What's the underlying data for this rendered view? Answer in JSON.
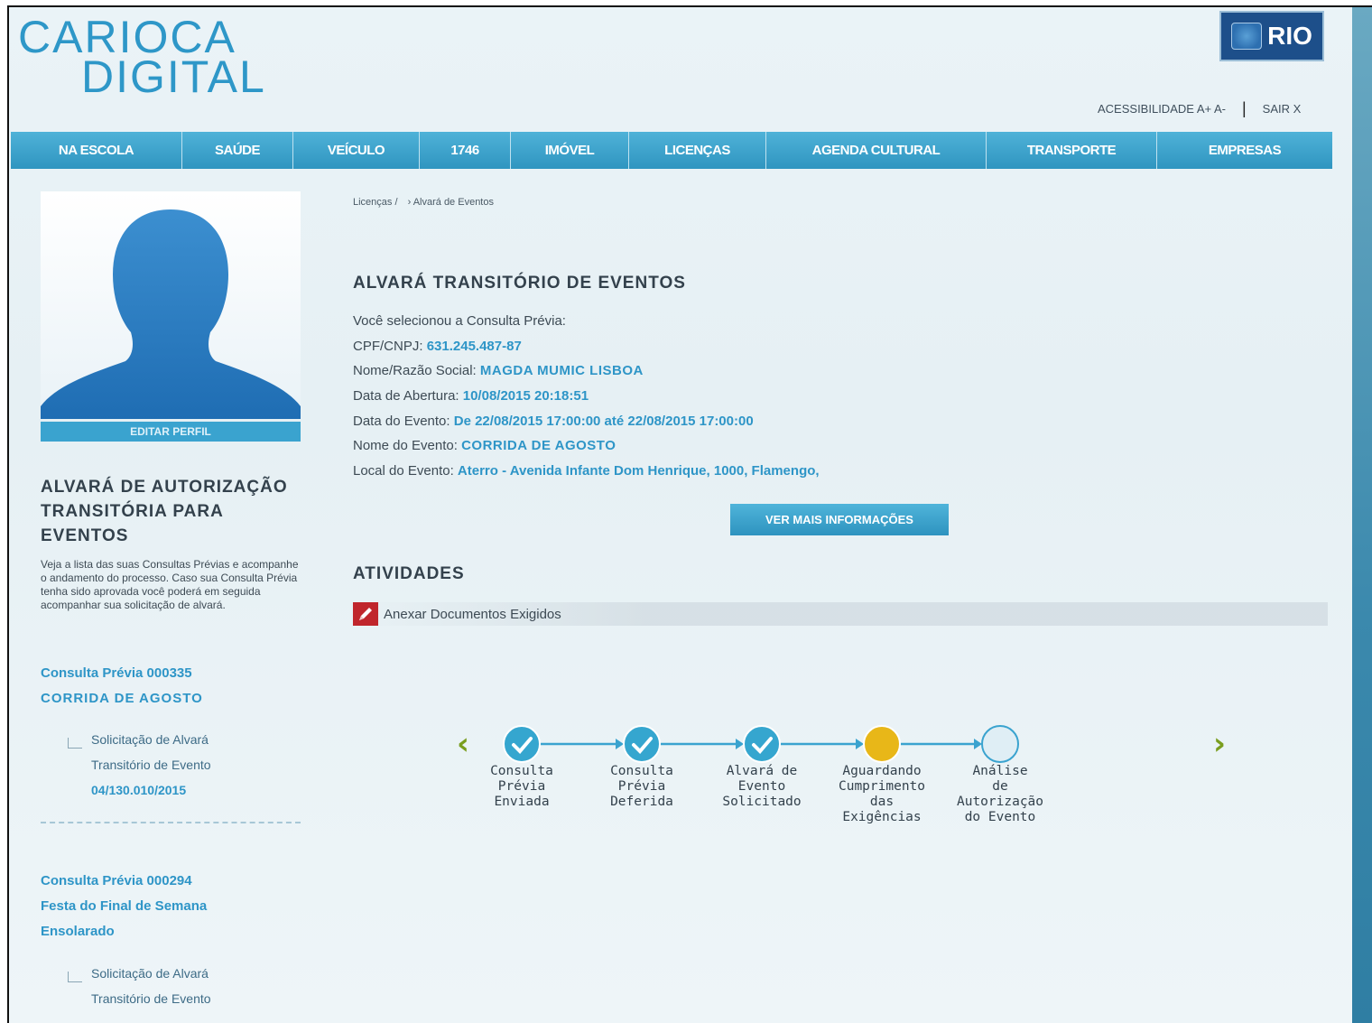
{
  "header": {
    "logo_line1": "CARIOCA",
    "logo_line2": "DIGITAL",
    "rio_badge": "RIO",
    "accessibility": "ACESSIBILIDADE A+ A-",
    "separator": "|",
    "logout": "SAIR X"
  },
  "nav": {
    "items": [
      {
        "label": "NA ESCOLA"
      },
      {
        "label": "SAÚDE"
      },
      {
        "label": "VEÍCULO"
      },
      {
        "label": "1746"
      },
      {
        "label": "IMÓVEL"
      },
      {
        "label": "LICENÇAS"
      },
      {
        "label": "AGENDA CULTURAL"
      },
      {
        "label": "TRANSPORTE"
      },
      {
        "label": "EMPRESAS"
      }
    ]
  },
  "sidebar": {
    "edit_profile": "EDITAR PERFIL",
    "title": "ALVARÁ DE AUTORIZAÇÃO TRANSITÓRIA PARA EVENTOS",
    "description": "Veja a lista das suas Consultas Prévias e acompanhe o andamento do processo. Caso sua Consulta Prévia tenha sido aprovada você poderá em seguida acompanhar sua solicitação de alvará.",
    "consultas": [
      {
        "label": "Consulta Prévia 000335",
        "event": "CORRIDA DE AGOSTO",
        "sub1": "Solicitação de Alvará",
        "sub2": "Transitório de Evento",
        "number": "04/130.010/2015"
      },
      {
        "label": "Consulta Prévia 000294",
        "event_line1": "Festa do Final de Semana",
        "event_line2": "Ensolarado",
        "sub1": "Solicitação de Alvará",
        "sub2": "Transitório de Evento"
      }
    ]
  },
  "breadcrumb": {
    "item1": "Licenças /",
    "item2": "› Alvará de Eventos"
  },
  "main": {
    "title": "ALVARÁ TRANSITÓRIO DE EVENTOS",
    "intro": "Você selecionou a Consulta Prévia:",
    "cpf_label": "CPF/CNPJ:",
    "cpf_value": "631.245.487-87",
    "nome_label": "Nome/Razão Social:",
    "nome_value": "MAGDA MUMIC LISBOA",
    "abertura_label": "Data de Abertura:",
    "abertura_value": "10/08/2015 20:18:51",
    "evento_data_label": "Data do Evento:",
    "evento_data_value": "De 22/08/2015 17:00:00 até 22/08/2015 17:00:00",
    "evento_nome_label": "Nome do Evento:",
    "evento_nome_value": "CORRIDA DE AGOSTO",
    "local_label": "Local do Evento:",
    "local_value": "Aterro - Avenida Infante Dom Henrique, 1000, Flamengo,",
    "more_button": "VER MAIS INFORMAÇÕES",
    "activities_title": "ATIVIDADES",
    "activity_1": "Anexar Documentos Exigidos"
  },
  "timeline": {
    "colors": {
      "done": "#35a6cf",
      "current": "#e8b718",
      "pending": "#dfeef5",
      "line": "#3aa3cf",
      "arrow": "#7a9e1f"
    },
    "steps": [
      {
        "state": "done",
        "lines": [
          "Consulta",
          "Prévia",
          "Enviada"
        ]
      },
      {
        "state": "done",
        "lines": [
          "Consulta",
          "Prévia",
          "Deferida"
        ]
      },
      {
        "state": "done",
        "lines": [
          "Alvará de",
          "Evento",
          "Solicitado"
        ]
      },
      {
        "state": "current",
        "lines": [
          "Aguardando",
          "Cumprimento",
          "das",
          "Exigências"
        ]
      },
      {
        "state": "pending",
        "lines": [
          "Análise",
          "de",
          "Autorização",
          "do Evento"
        ]
      }
    ],
    "prev_arrow": "‹",
    "next_arrow": "›"
  }
}
